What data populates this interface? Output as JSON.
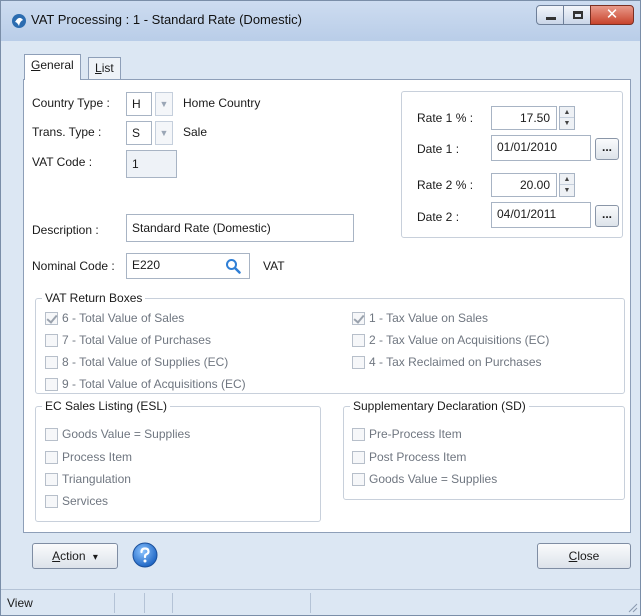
{
  "window": {
    "title": "VAT Processing : 1 - Standard Rate (Domestic)"
  },
  "tabs": [
    {
      "label": "General",
      "hotkey": "G",
      "rest": "eneral",
      "active": true
    },
    {
      "label": "List",
      "hotkey": "L",
      "rest": "ist",
      "active": false
    }
  ],
  "general": {
    "country_type": {
      "label": "Country Type :",
      "value": "H",
      "description": "Home Country"
    },
    "trans_type": {
      "label": "Trans. Type :",
      "value": "S",
      "description": "Sale"
    },
    "vat_code": {
      "label": "VAT Code :",
      "value": "1"
    },
    "description": {
      "label": "Description :",
      "value": "Standard Rate (Domestic)"
    },
    "nominal_code": {
      "label": "Nominal Code :",
      "value": "E220",
      "description": "VAT"
    }
  },
  "rates": {
    "rate1": {
      "label": "Rate 1 % :",
      "value": "17.50"
    },
    "date1": {
      "label": "Date 1 :",
      "value": "01/01/2010"
    },
    "rate2": {
      "label": "Rate 2 % :",
      "value": "20.00"
    },
    "date2": {
      "label": "Date 2 :",
      "value": "04/01/2011"
    },
    "browse_label": "..."
  },
  "vat_return_boxes": {
    "title": "VAT Return Boxes",
    "left": [
      {
        "label": "6 - Total Value of Sales",
        "checked": true
      },
      {
        "label": "7 - Total Value of Purchases",
        "checked": false
      },
      {
        "label": "8 - Total Value of Supplies (EC)",
        "checked": false
      },
      {
        "label": "9 - Total Value of Acquisitions (EC)",
        "checked": false
      }
    ],
    "right": [
      {
        "label": "1 - Tax Value on Sales",
        "checked": true
      },
      {
        "label": "2 - Tax Value on Acquisitions (EC)",
        "checked": false
      },
      {
        "label": "4 - Tax Reclaimed on Purchases",
        "checked": false
      }
    ]
  },
  "esl": {
    "title": "EC Sales Listing (ESL)",
    "items": [
      {
        "label": "Goods Value = Supplies",
        "checked": false
      },
      {
        "label": "Process Item",
        "checked": false
      },
      {
        "label": "Triangulation",
        "checked": false
      },
      {
        "label": "Services",
        "checked": false
      }
    ]
  },
  "sd": {
    "title": "Supplementary Declaration (SD)",
    "items": [
      {
        "label": "Pre-Process Item",
        "checked": false
      },
      {
        "label": "Post Process Item",
        "checked": false
      },
      {
        "label": "Goods Value = Supplies",
        "checked": false
      }
    ]
  },
  "buttons": {
    "action": {
      "hotkey": "A",
      "rest": "ction",
      "arrow": "▾"
    },
    "close": {
      "hotkey": "C",
      "rest": "lose"
    }
  },
  "statusbar": {
    "text": "View"
  },
  "colors": {
    "window_bg": "#dce7f3",
    "close_button": "#c8442c",
    "help_icon": "#2f7fd6"
  }
}
